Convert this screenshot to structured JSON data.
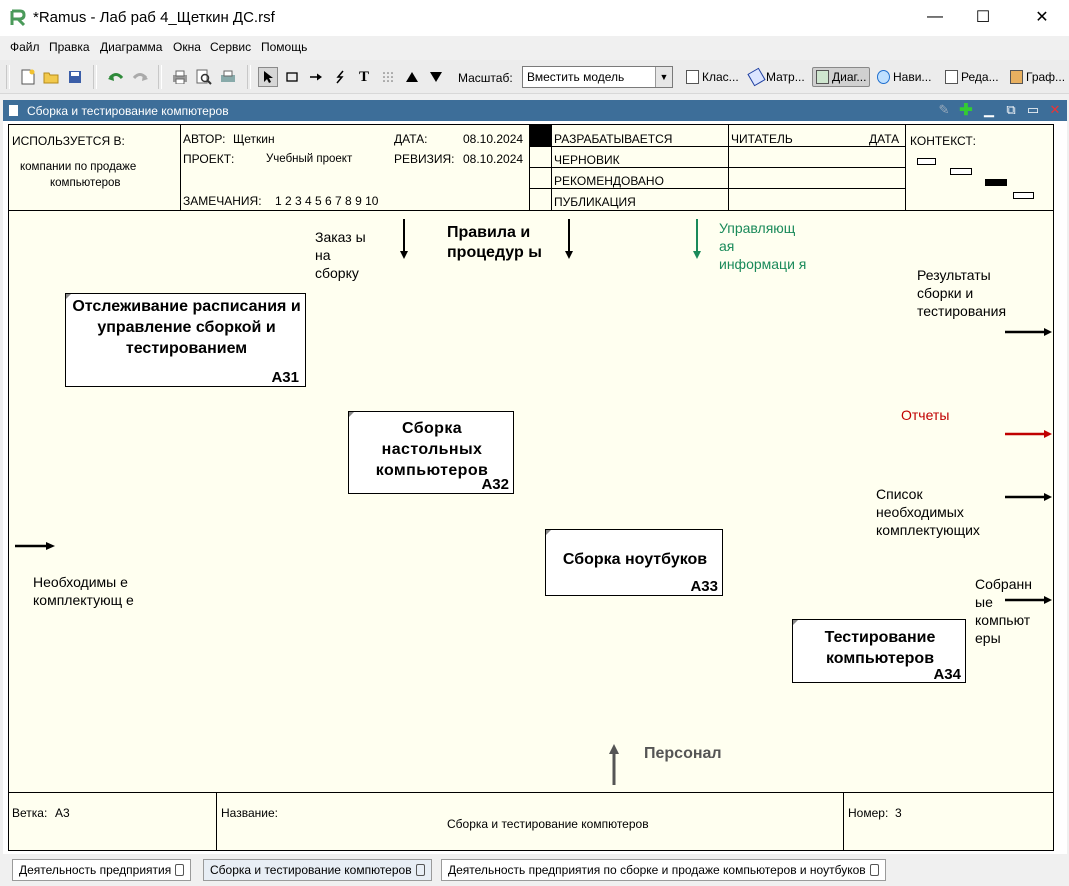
{
  "window": {
    "title": "*Ramus - Лаб раб 4_Щеткин ДС.rsf",
    "minimize": "—",
    "maximize": "☐",
    "close": "✕"
  },
  "menu": [
    "Файл",
    "Правка",
    "Диаграмма",
    "Окна",
    "Сервис",
    "Помощь"
  ],
  "toolbar": {
    "scale_label": "Масштаб:",
    "scale_value": "Вместить модель",
    "views": [
      "Клас...",
      "Матр...",
      "Диаг...",
      "Нави...",
      "Реда...",
      "Граф..."
    ]
  },
  "document": {
    "title": "Сборка и тестирование компютеров"
  },
  "header": {
    "used_in_label": "ИСПОЛЬЗУЕТСЯ В:",
    "used_in_value_1": "компании по продаже",
    "used_in_value_2": "компьютеров",
    "author_label": "АВТОР:",
    "author_value": "Щеткин",
    "project_label": "ПРОЕКТ:",
    "project_value": "Учебный проект",
    "notes_label": "ЗАМЕЧАНИЯ:",
    "notes_value": "1 2 3 4 5 6 7 8 9 10",
    "date_label": "ДАТА:",
    "date_value": "08.10.2024",
    "revision_label": "РЕВИЗИЯ:",
    "revision_value": "08.10.2024",
    "status": [
      "РАЗРАБАТЫВАЕТСЯ",
      "ЧЕРНОВИК",
      "РЕКОМЕНДОВАНО",
      "ПУБЛИКАЦИЯ"
    ],
    "reader_label": "ЧИТАТЕЛЬ",
    "reader_date_label": "ДАТА",
    "context_label": "КОНТЕКСТ:"
  },
  "boxes": [
    {
      "label": "Отслеживание расписания и управление сборкой и тестированием",
      "number": "A31"
    },
    {
      "label": "Сборка настольных компьютеров",
      "number": "A32"
    },
    {
      "label": "Сборка ноутбуков",
      "number": "A33"
    },
    {
      "label": "Тестирование компьютеров",
      "number": "A34"
    }
  ],
  "arrows": {
    "order": "Заказ ы на сборку",
    "rules": "Правила и процедур ы",
    "control_info": "Управляющ ая информаци я",
    "results": "Результаты сборки и тестирования",
    "reports": "Отчеты",
    "components_list": "Список необходимых комплектующих",
    "assembled": "Собранн ые компьют еры",
    "required": "Необходимы е комплектующ е",
    "personnel": "Персонал"
  },
  "colors": {
    "control_info": "#1a8a5a",
    "reports": "#c00000",
    "personnel": "#555555"
  },
  "footer": {
    "branch_label": "Ветка:",
    "branch_value": "A3",
    "name_label": "Название:",
    "name_value": "Сборка и тестирование компютеров",
    "number_label": "Номер:",
    "number_value": "3"
  },
  "tabs": [
    "Деятельность предприятия",
    "Сборка и тестирование компютеров",
    "Деятельность предприятия по сборке и продаже компьютеров и ноутбуков"
  ]
}
